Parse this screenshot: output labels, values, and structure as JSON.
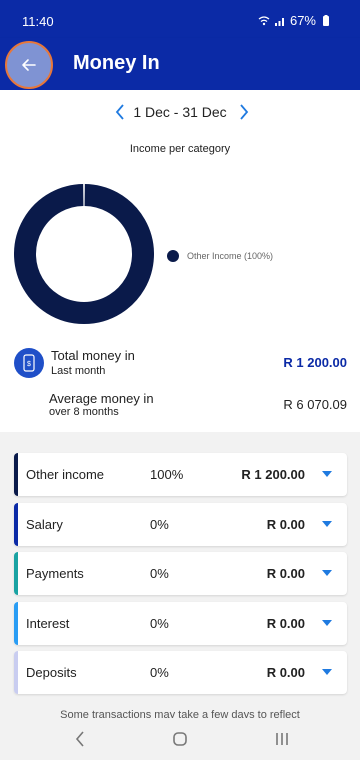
{
  "status": {
    "time": "11:40",
    "battery": "67%",
    "icons": [
      "wifi-icon",
      "signal-icon",
      "battery-icon"
    ]
  },
  "header": {
    "title": "Money In",
    "back_icon": "arrow-left-icon"
  },
  "period": {
    "label": "1 Dec - 31 Dec",
    "prev_icon": "chevron-left-icon",
    "next_icon": "chevron-right-icon"
  },
  "chart_data": {
    "type": "pie",
    "title": "Income per category",
    "categories": [
      "Other Income"
    ],
    "values": [
      100
    ],
    "legend": [
      {
        "label": "Other Income (100%)",
        "color": "#0a1a4a"
      }
    ],
    "legend_position": "right",
    "donut": true
  },
  "summary": {
    "total_label": "Total money in",
    "total_sub": "Last month",
    "total_value": "R 1 200.00",
    "average_label": "Average money in",
    "average_sub": "over 8 months",
    "average_value": "R 6 070.09"
  },
  "categories": [
    {
      "name": "Other income",
      "percent": "100%",
      "amount": "R 1 200.00",
      "color": "#0a1a4a"
    },
    {
      "name": "Salary",
      "percent": "0%",
      "amount": "R 0.00",
      "color": "#0b2aa6"
    },
    {
      "name": "Payments",
      "percent": "0%",
      "amount": "R 0.00",
      "color": "#1aa3a3"
    },
    {
      "name": "Interest",
      "percent": "0%",
      "amount": "R 0.00",
      "color": "#2a9df4"
    },
    {
      "name": "Deposits",
      "percent": "0%",
      "amount": "R 0.00",
      "color": "#c9cdf0"
    }
  ],
  "footnote": "Some transactions may take a few days to reflect",
  "colors": {
    "primary": "#0b2aa6",
    "accent": "#1f7ae0",
    "donut": "#0a1a4a"
  }
}
